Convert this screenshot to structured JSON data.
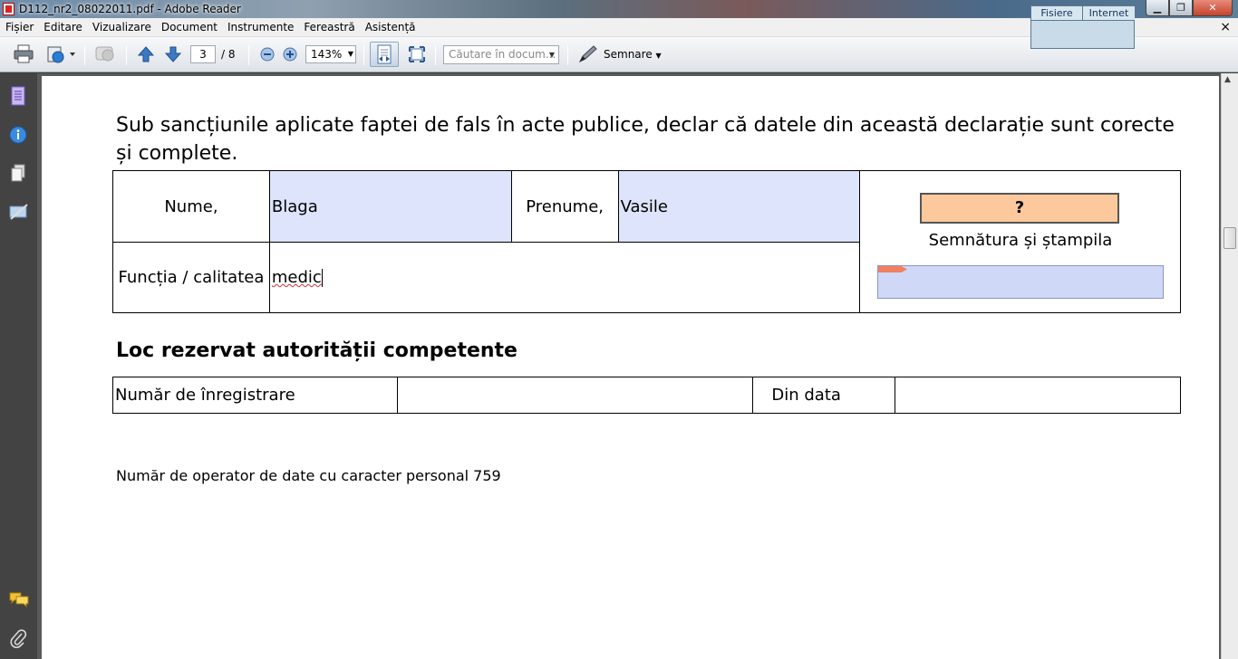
{
  "window": {
    "title": "D112_nr2_08022011.pdf - Adobe Reader",
    "widget_tabs": [
      "Fisiere",
      "Internet"
    ]
  },
  "menu": {
    "items": [
      "Fișier",
      "Editare",
      "Vizualizare",
      "Document",
      "Instrumente",
      "Fereastră",
      "Asistență"
    ],
    "close_doc": "×"
  },
  "toolbar": {
    "page_current": "3",
    "page_total": "/ 8",
    "zoom": "143%",
    "search_placeholder": "Căutare în docum...",
    "sign_label": "Semnare"
  },
  "document": {
    "declaration": "Sub sancțiunile aplicate faptei de fals în acte publice, declar că datele din această declarație sunt corecte și complete.",
    "signer_table": {
      "name_label": "Nume,",
      "name_value": "Blaga",
      "firstname_label": "Prenume,",
      "firstname_value": "Vasile",
      "function_label": "Funcția / calitatea",
      "function_value": "medic",
      "signature_button": "?",
      "signature_label": "Semnătura și ștampila"
    },
    "authority_title": "Loc rezervat autorității competente",
    "registration_table": {
      "number_label": "Număr de înregistrare",
      "number_value": "",
      "date_label": "Din data",
      "date_value": ""
    },
    "operator_text": "Număr de operator de date cu caracter personal 759"
  }
}
